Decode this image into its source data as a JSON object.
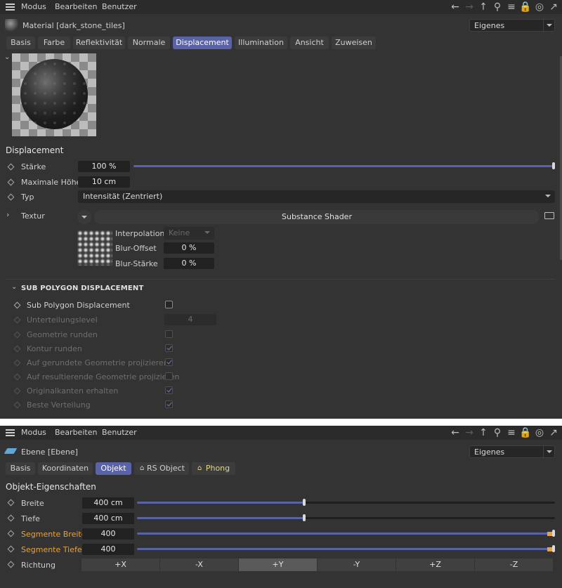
{
  "panel1": {
    "menu": {
      "mode": "Modus",
      "edit": "Bearbeiten",
      "user": "Benutzer"
    },
    "toolbar_icons": [
      "arrow-left-icon",
      "arrow-right-icon",
      "arrow-up-icon",
      "search-icon",
      "filter-icon",
      "lock-icon",
      "target-icon",
      "external-icon"
    ],
    "title": "Material [dark_stone_tiles]",
    "view_mode": "Eigenes",
    "tabs": [
      "Basis",
      "Farbe",
      "Reflektivität",
      "Normale",
      "Displacement",
      "Illumination",
      "Ansicht",
      "Zuweisen"
    ],
    "active_tab": "Displacement",
    "section": "Displacement",
    "params": {
      "strength_label": "Stärke",
      "strength_value": "100 %",
      "strength_fraction": 1.0,
      "max_height_label": "Maximale Höhe",
      "max_height_value": "10 cm",
      "type_label": "Typ",
      "type_value": "Intensität (Zentriert)",
      "texture_label": "Textur",
      "texture_shader": "Substance Shader",
      "interpolation_label": "Interpolation",
      "interpolation_value": "Keine",
      "blur_offset_label": "Blur-Offset",
      "blur_offset_value": "0 %",
      "blur_strength_label": "Blur-Stärke",
      "blur_strength_value": "0 %"
    },
    "subpoly": {
      "title": "SUB POLYGON DISPLACEMENT",
      "items": [
        {
          "label": "Sub Polygon Displacement",
          "checked": false,
          "enabled": true
        },
        {
          "label": "Unterteilungslevel",
          "value": "4",
          "enabled": false
        },
        {
          "label": "Geometrie runden",
          "checked": false,
          "enabled": false
        },
        {
          "label": "Kontur runden",
          "checked": true,
          "enabled": false
        },
        {
          "label": "Auf gerundete Geometrie projizieren",
          "checked": true,
          "enabled": false
        },
        {
          "label": "Auf resultierende Geometrie projizieren",
          "checked": false,
          "enabled": false
        },
        {
          "label": "Originalkanten erhalten",
          "checked": true,
          "enabled": false
        },
        {
          "label": "Beste Verteilung",
          "checked": true,
          "enabled": false
        }
      ]
    }
  },
  "panel2": {
    "menu": {
      "mode": "Modus",
      "edit": "Bearbeiten",
      "user": "Benutzer"
    },
    "title": "Ebene [Ebene]",
    "view_mode": "Eigenes",
    "tabs": [
      "Basis",
      "Koordinaten",
      "Objekt",
      "RS Object",
      "Phong"
    ],
    "active_tab": "Objekt",
    "section": "Objekt-Eigenschaften",
    "rows": [
      {
        "label": "Breite",
        "value": "400 cm",
        "fraction": 0.4
      },
      {
        "label": "Tiefe",
        "value": "400 cm",
        "fraction": 0.4
      },
      {
        "label": "Segmente Breite",
        "value": "400",
        "fraction": 1.0
      },
      {
        "label": "Segmente Tiefe",
        "value": "400",
        "fraction": 1.0
      }
    ],
    "direction_label": "Richtung",
    "direction_options": [
      "+X",
      "-X",
      "+Y",
      "-Y",
      "+Z",
      "-Z"
    ],
    "direction_selected": "+Y",
    "colors": {
      "accent": "#5a63a8",
      "highlight": "#e8a23a",
      "background": "#333333"
    }
  }
}
